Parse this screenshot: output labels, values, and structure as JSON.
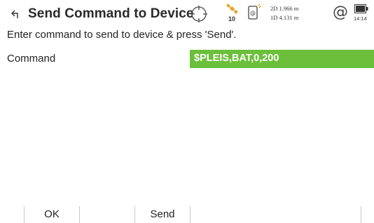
{
  "title": "Send Command to Device",
  "status": {
    "satellites": "10",
    "precision_2d": "2D 1.966 m",
    "precision_1d": "1D 4.131 m",
    "time": "14:14"
  },
  "instruction": "Enter command to send to device & press 'Send'.",
  "command": {
    "label": "Command",
    "value": "$PLEIS,BAT,0,200"
  },
  "softkeys": {
    "ok": "OK",
    "send": "Send"
  },
  "colors": {
    "input_accent": "#6bbf3a"
  }
}
